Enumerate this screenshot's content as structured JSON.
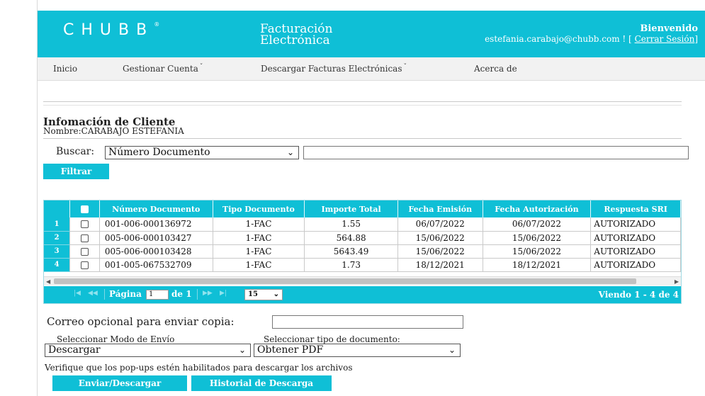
{
  "header": {
    "logo": "CHUBB",
    "app_title_line1": "Facturación",
    "app_title_line2": "Electrónica",
    "welcome": "Bienvenido",
    "user_email": "estefania.carabajo@chubb.com ! [",
    "logout": "Cerrar Sesión",
    "logout_close": "]"
  },
  "nav": {
    "items": [
      {
        "label": "Inicio",
        "has_caret": false
      },
      {
        "label": "Gestionar Cuenta",
        "has_caret": true
      },
      {
        "label": "Descargar Facturas Electrónicas",
        "has_caret": true
      },
      {
        "label": "Acerca de",
        "has_caret": false
      }
    ]
  },
  "client": {
    "title": "Infomación de Cliente",
    "name": "Nombre:CARABAJO ESTEFANIA"
  },
  "search": {
    "label": "Buscar:",
    "field_selected": "Número Documento",
    "value": "",
    "filter_button": "Filtrar"
  },
  "grid": {
    "columns": [
      "",
      "Número Documento",
      "Tipo Documento",
      "Importe Total",
      "Fecha Emisión",
      "Fecha Autorización",
      "Respuesta SRI"
    ],
    "rows": [
      {
        "n": "1",
        "numero": "001-006-000136972",
        "tipo": "1-FAC",
        "importe": "1.55",
        "emision": "06/07/2022",
        "autorizacion": "06/07/2022",
        "sri": "AUTORIZADO"
      },
      {
        "n": "2",
        "numero": "005-006-000103427",
        "tipo": "1-FAC",
        "importe": "564.88",
        "emision": "15/06/2022",
        "autorizacion": "15/06/2022",
        "sri": "AUTORIZADO"
      },
      {
        "n": "3",
        "numero": "005-006-000103428",
        "tipo": "1-FAC",
        "importe": "5643.49",
        "emision": "15/06/2022",
        "autorizacion": "15/06/2022",
        "sri": "AUTORIZADO"
      },
      {
        "n": "4",
        "numero": "001-005-067532709",
        "tipo": "1-FAC",
        "importe": "1.73",
        "emision": "18/12/2021",
        "autorizacion": "18/12/2021",
        "sri": "AUTORIZADO"
      }
    ],
    "pager": {
      "page_label": "Página",
      "page_value": "1",
      "of_label": "de 1",
      "per_page": "15",
      "viewing": "Viendo 1 - 4 de 4"
    }
  },
  "send": {
    "mail_label": "Correo opcional para enviar copia:",
    "mail_value": "",
    "mode_label": "Seleccionar Modo de Envío",
    "mode_value": "Descargar",
    "doc_type_label": "Seleccionar tipo de documento:",
    "doc_type_value": "Obtener PDF",
    "note": "Verifique que los pop-ups estén habilitados para descargar los archivos",
    "send_button": "Enviar/Descargar",
    "history_button": "Historial de Descarga"
  },
  "colors": {
    "accent": "#0fbfd6",
    "nav_bg": "#f2f2f2"
  }
}
